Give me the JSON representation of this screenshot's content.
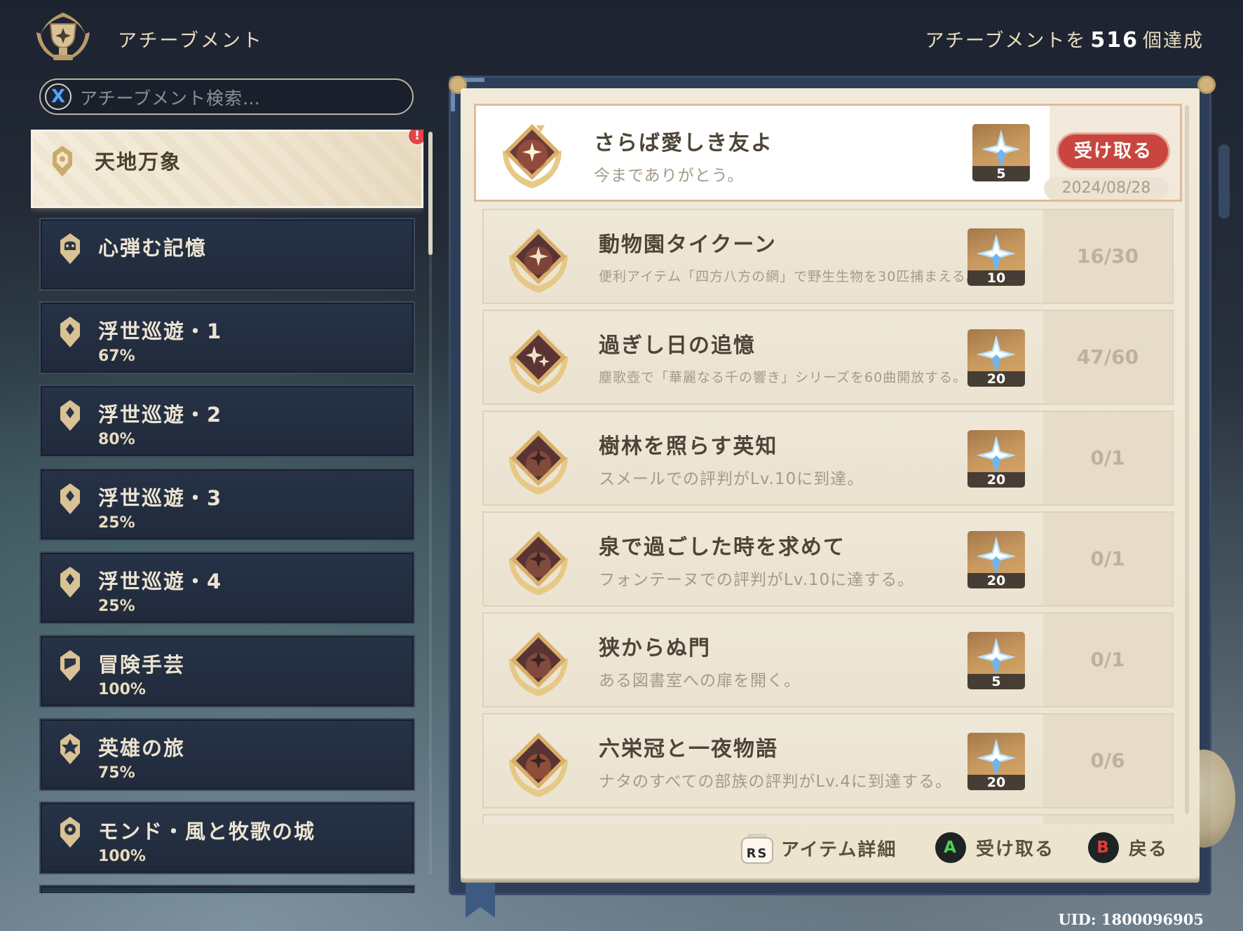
{
  "header": {
    "title": "アチーブメント",
    "count_prefix": "アチーブメントを",
    "count": "516",
    "count_suffix": "個達成"
  },
  "search": {
    "button_label": "X",
    "placeholder": "アチーブメント検索…"
  },
  "categories": [
    {
      "name": "天地万象",
      "percent": "",
      "active": true,
      "alert": "!"
    },
    {
      "name": "心弾む記憶",
      "percent": ""
    },
    {
      "name": "浮世巡遊・1",
      "percent": "67%"
    },
    {
      "name": "浮世巡遊・2",
      "percent": "80%"
    },
    {
      "name": "浮世巡遊・3",
      "percent": "25%"
    },
    {
      "name": "浮世巡遊・4",
      "percent": "25%"
    },
    {
      "name": "冒険手芸",
      "percent": "100%"
    },
    {
      "name": "英雄の旅",
      "percent": "75%"
    },
    {
      "name": "モンド・風と牧歌の城",
      "percent": "100%"
    }
  ],
  "achievements": [
    {
      "title": "さらば愛しき友よ",
      "desc": "今までありがとう。",
      "reward": "5",
      "claim_label": "受け取る",
      "date": "2024/08/28"
    },
    {
      "title": "動物園タイクーン",
      "desc": "便利アイテム「四方八方の網」で野生生物を30匹捕まえる。",
      "reward": "10",
      "progress": "16/30"
    },
    {
      "title": "過ぎし日の追憶",
      "desc": "塵歌壺で「華麗なる千の響き」シリーズを60曲開放する。",
      "reward": "20",
      "progress": "47/60"
    },
    {
      "title": "樹林を照らす英知",
      "desc": "スメールでの評判がLv.10に到達。",
      "reward": "20",
      "progress": "0/1"
    },
    {
      "title": "泉で過ごした時を求めて",
      "desc": "フォンテーヌでの評判がLv.10に達する。",
      "reward": "20",
      "progress": "0/1"
    },
    {
      "title": "狭からぬ門",
      "desc": "ある図書室への扉を開く。",
      "reward": "5",
      "progress": "0/1"
    },
    {
      "title": "六栄冠と一夜物語",
      "desc": "ナタのすべての部族の評判がLv.4に到達する。",
      "reward": "20",
      "progress": "0/6"
    }
  ],
  "footer": {
    "rs_label": "RS",
    "item_detail": "アイテム詳細",
    "a_button": "A",
    "a_label": "受け取る",
    "b_button": "B",
    "b_label": "戻る"
  },
  "uid": "UID: 1800096905",
  "colors": {
    "claim_button": "#c8463f",
    "a_button": "#4ed04e",
    "b_button": "#e23b3b",
    "search_x": "#4fa5ff"
  },
  "icons": [
    "trophy-emblem-icon",
    "category-icon",
    "achievement-medal-icon",
    "primogem-icon",
    "rs-stick-icon"
  ]
}
